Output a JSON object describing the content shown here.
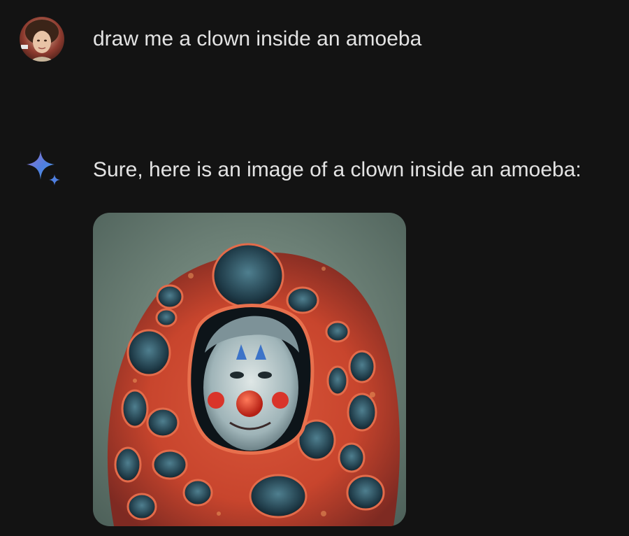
{
  "conversation": {
    "user_message": {
      "text": "draw me a clown inside an amoeba",
      "avatar_icon": "user-avatar"
    },
    "assistant_message": {
      "text": "Sure, here is an image of a clown inside an amoeba:",
      "icon": "sparkle-icon",
      "image_description_icon": "generated-image"
    }
  },
  "colors": {
    "background": "#131313",
    "text": "#e3e3e3",
    "accent_blue": "#4f7fe0",
    "accent_purple": "#9b72cb"
  }
}
